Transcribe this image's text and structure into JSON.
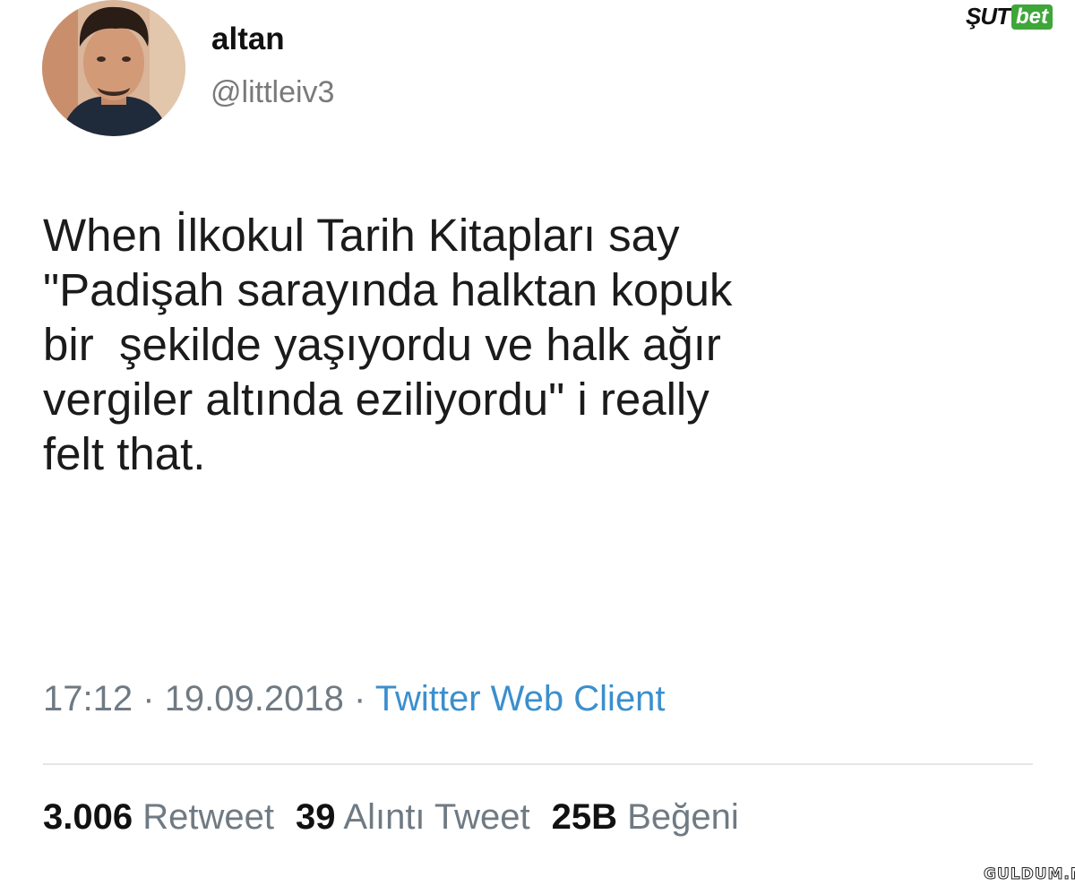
{
  "author": {
    "display_name": "altan",
    "handle": "@littleiv3",
    "avatar": "profile-photo"
  },
  "tweet": {
    "text": "When İlkokul Tarih Kitapları say\n\"Padişah sarayında halktan kopuk\nbir  şekilde yaşıyordu ve halk ağır\nvergiler altında eziliyordu\" i really\nfelt that.",
    "time": "17:12",
    "separator": "·",
    "date": "19.09.2018",
    "client": "Twitter Web Client"
  },
  "stats": {
    "retweets_count": "3.006",
    "retweets_label": "Retweet",
    "quotes_count": "39",
    "quotes_label": "Alıntı Tweet",
    "likes_count": "25B",
    "likes_label": "Beğeni"
  },
  "watermarks": {
    "top_right_part1": "ŞUT",
    "top_right_part2": "bet",
    "bottom_right": "GULDUM.NET"
  }
}
